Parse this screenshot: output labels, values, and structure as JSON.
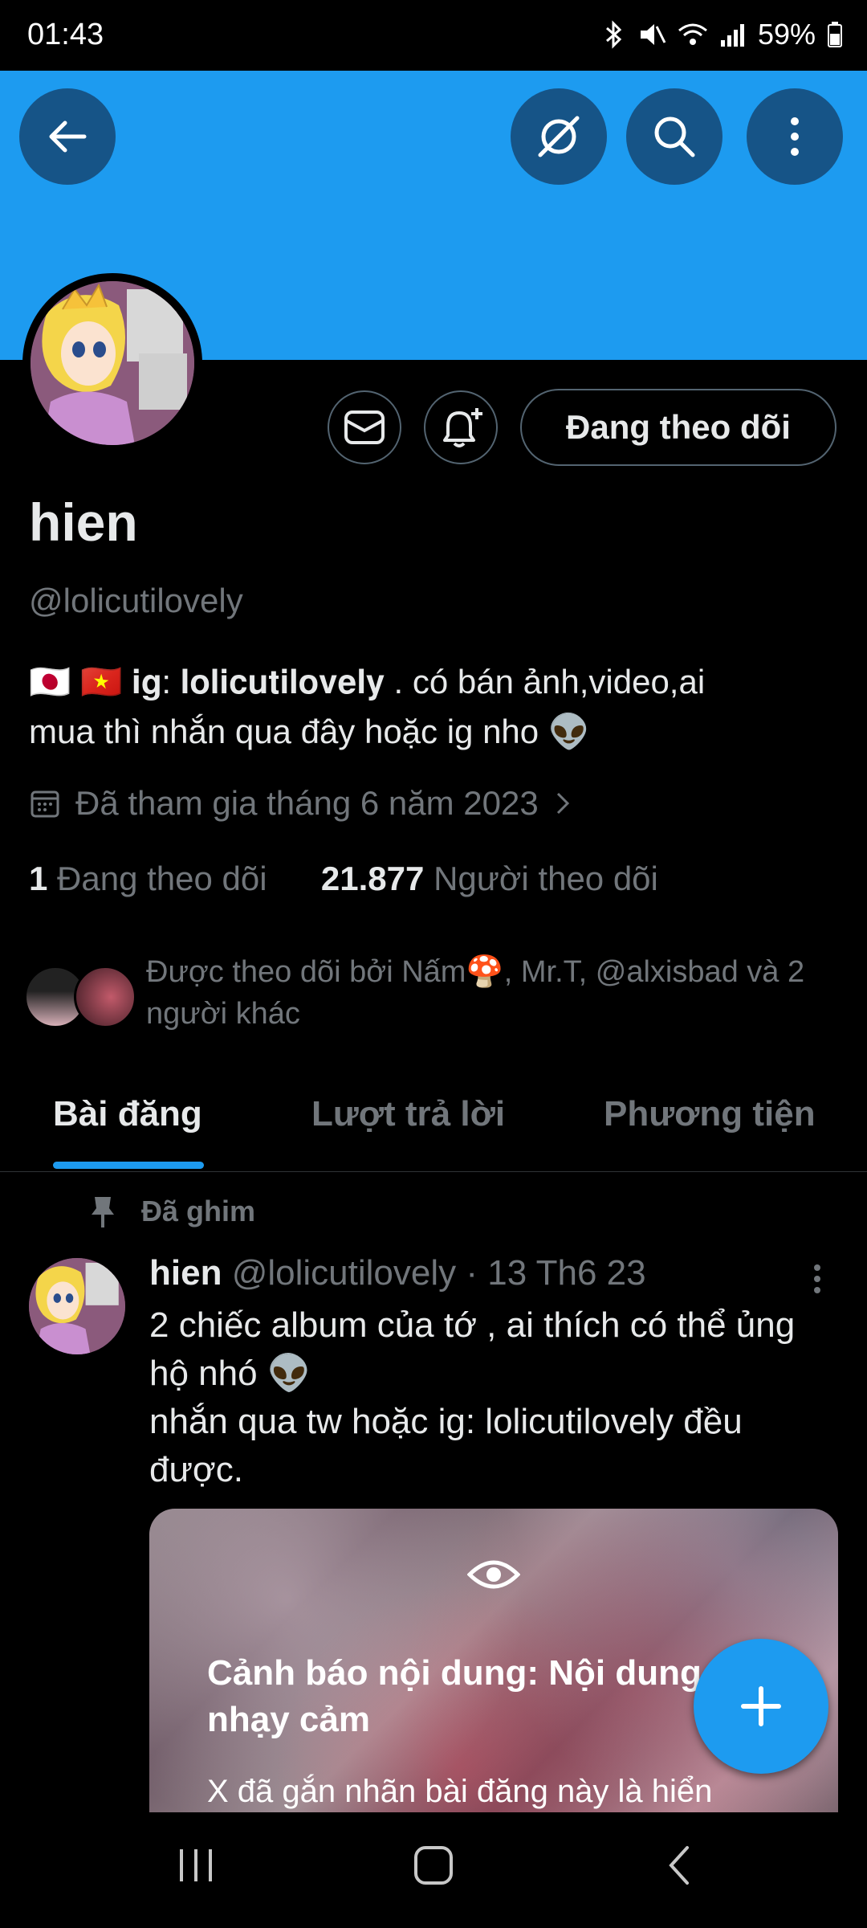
{
  "status_bar": {
    "time": "01:43",
    "battery": "59%"
  },
  "header": {
    "back_icon": "arrow-left-icon",
    "grok_icon": "grok-icon",
    "search_icon": "search-icon",
    "more_icon": "more-vertical-icon"
  },
  "profile": {
    "name": "hien",
    "handle": "@lolicutilovely",
    "bio_line1": "🇯🇵 🇻🇳 𝐢𝐠: 𝐥𝐨𝐥𝐢𝐜𝐮𝐭𝐢𝐥𝐨𝐯𝐞𝐥𝐲     .    có bán ảnh,video,ai",
    "bio_line2": "mua thì nhắn qua đây hoặc ig nho 👽",
    "joined": "Đã tham gia tháng 6 năm 2023",
    "following_count": "1",
    "following_label": "Đang theo dõi",
    "followers_count": "21.877",
    "followers_label": "Người theo dõi",
    "followed_by": "Được theo dõi bởi Nấm🍄, Mr.T, @alxisbad và 2 người khác",
    "follow_button": "Đang theo dõi"
  },
  "tabs": [
    {
      "label": "Bài đăng",
      "active": true
    },
    {
      "label": "Lượt trả lời",
      "active": false
    },
    {
      "label": "Phương tiện",
      "active": false
    }
  ],
  "post": {
    "pinned_label": "Đã ghim",
    "author": "hien",
    "handle": "@lolicutilovely",
    "time": "· 13 Th6 23",
    "text_line1": "2 chiếc album của tớ , ai thích có thể ủng",
    "text_line2": "hộ nhó 👽",
    "text_line3": "nhắn qua tw hoặc ig: lolicutilovely đều",
    "text_line4": "được.",
    "warning_title": "Cảnh báo nội dung: Nội dung nhạy cảm",
    "warning_sub": "X đã gắn nhãn bài đăng này là hiển"
  },
  "colors": {
    "accent": "#1d9bf0",
    "background": "#000000",
    "muted": "#71767b"
  }
}
